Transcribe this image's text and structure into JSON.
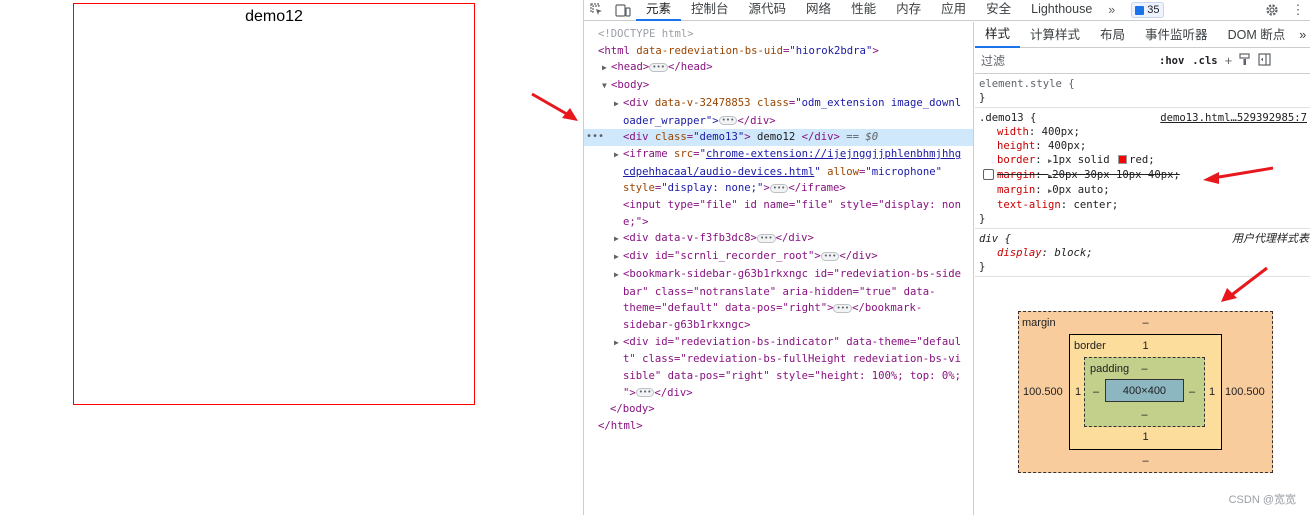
{
  "preview": {
    "demo_text": "demo12"
  },
  "toolbar": {
    "tabs": [
      "元素",
      "控制台",
      "源代码",
      "网络",
      "性能",
      "内存",
      "应用",
      "安全",
      "Lighthouse"
    ],
    "more": "»",
    "issues_count": "35"
  },
  "elements": {
    "lines": [
      {
        "doctype": "<!DOCTYPE html>"
      },
      {
        "open": "<html",
        "attrs": [
          [
            "data-redeviation-bs-uid",
            "hiorok2bdra"
          ]
        ],
        "close": ">"
      },
      {
        "tag_collapsed_open": "<head>",
        "tag_collapsed_close": "</head>"
      },
      {
        "body_open": "<body>"
      },
      {
        "div_attrs": [
          [
            "data-v-32478853",
            ""
          ],
          [
            "class",
            "odm_extension image_downl"
          ]
        ],
        "cont": "oader_wrapper\">",
        "end": "</div>"
      },
      {
        "selected_open": "<div class=\"demo13\">",
        "text": " demo12 ",
        "close": "</div>",
        "eq": "== $0"
      },
      {
        "iframe_src": "chrome-extension://ijejnggjjphlenbhmjhhg",
        "iframe_src2": "cdpehhacaal/audio-devices.html",
        "allow": "microphone",
        "style": "display: none;",
        "end": "</iframe>"
      },
      {
        "input_line": "<input type=\"file\" id name=\"file\" style=\"display: non",
        "input_cont": "e;\">"
      },
      {
        "div_fb": "<div data-v-f3fb3dc8>",
        "end": "</div>"
      },
      {
        "div_rec": "<div id=\"scrnli_recorder_root\">",
        "end": "</div>"
      },
      {
        "bookmark1": "<bookmark-sidebar-g63b1rkxngc id=\"redeviation-bs-side",
        "bookmark2": "bar\" class=\"notranslate\" aria-hidden=\"true\" data-",
        "bookmark3": "theme=\"default\" data-pos=\"right\">",
        "bookmark_end": "</bookmark-",
        "bookmark4": "sidebar-g63b1rkxngc>"
      },
      {
        "ind1": "<div id=\"redeviation-bs-indicator\" data-theme=\"defaul",
        "ind2": "t\" class=\"redeviation-bs-fullHeight redeviation-bs-vi",
        "ind3": "sible\" data-pos=\"right\" style=\"height: 100%; top: 0%;",
        "ind4": "\">",
        "ind_end": "</div>"
      },
      {
        "body_close": "</body>"
      },
      {
        "html_close": "</html>"
      }
    ]
  },
  "styles": {
    "tabs": [
      "样式",
      "计算样式",
      "布局",
      "事件监听器",
      "DOM 断点"
    ],
    "more": "»",
    "filter_placeholder": "过滤",
    "hov": ":hov",
    "cls": ".cls",
    "element_style": "element.style {",
    "close_brace": "}",
    "rule_selector": ".demo13 {",
    "rule_source": "demo13.html…529392985:7",
    "decls": {
      "width": {
        "name": "width",
        "value": "400px;"
      },
      "height": {
        "name": "height",
        "value": "400px;"
      },
      "border": {
        "name": "border",
        "value": "1px solid",
        "value2": "red;"
      },
      "margin_struck": {
        "name": "margin",
        "value": "20px 30px 10px 40px;"
      },
      "margin": {
        "name": "margin",
        "value": "0px auto;"
      },
      "text_align": {
        "name": "text-align",
        "value": "center;"
      }
    },
    "ua_selector": "div {",
    "ua_source": "用户代理样式表",
    "ua_decl": {
      "name": "display",
      "value": "block;"
    }
  },
  "boxmodel": {
    "margin_label": "margin",
    "margin_top": "–",
    "margin_bottom": "–",
    "margin_left": "100.500",
    "margin_right": "100.500",
    "border_label": "border",
    "border_top": "1",
    "border_bottom": "1",
    "border_left": "1",
    "border_right": "1",
    "padding_label": "padding",
    "padding_top": "–",
    "padding_bottom": "–",
    "padding_left": "–",
    "padding_right": "–",
    "content": "400×400"
  },
  "watermark": "CSDN @宽宽",
  "colors": {
    "accent": "#1a73e8",
    "arrow": "#e8171c",
    "border_red": "#ff0000"
  }
}
